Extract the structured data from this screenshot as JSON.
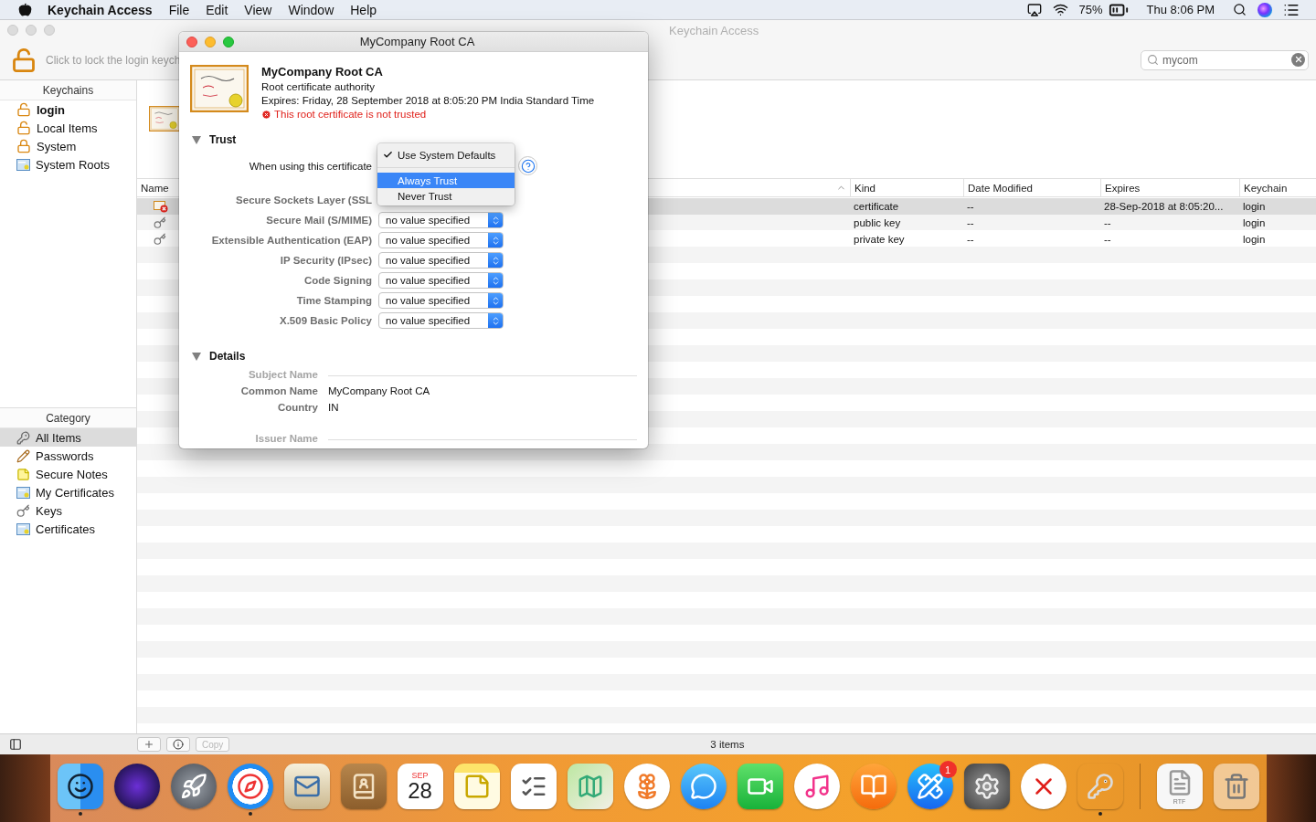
{
  "menubar": {
    "app": "Keychain Access",
    "menus": [
      "File",
      "Edit",
      "View",
      "Window",
      "Help"
    ],
    "battery": "75%",
    "clock": "Thu 8:06 PM"
  },
  "window": {
    "title": "Keychain Access",
    "lock_hint": "Click to lock the login keych",
    "search": {
      "value": "mycom"
    }
  },
  "keychains": {
    "header": "Keychains",
    "items": [
      {
        "label": "login",
        "default": true,
        "kind": "unlocked"
      },
      {
        "label": "Local Items",
        "default": false,
        "kind": "unlocked"
      },
      {
        "label": "System",
        "default": false,
        "kind": "locked"
      },
      {
        "label": "System Roots",
        "default": false,
        "kind": "cabinet"
      }
    ]
  },
  "categories": {
    "header": "Category",
    "items": [
      {
        "label": "All Items",
        "selected": true,
        "kind": "keys"
      },
      {
        "label": "Passwords",
        "selected": false,
        "kind": "pencil"
      },
      {
        "label": "Secure Notes",
        "selected": false,
        "kind": "note"
      },
      {
        "label": "My Certificates",
        "selected": false,
        "kind": "mycert"
      },
      {
        "label": "Keys",
        "selected": false,
        "kind": "key"
      },
      {
        "label": "Certificates",
        "selected": false,
        "kind": "cert"
      }
    ]
  },
  "table": {
    "columns": [
      "Name",
      "Kind",
      "Date Modified",
      "Expires",
      "Keychain"
    ],
    "rows": [
      {
        "kind": "certificate-error",
        "type": "certificate",
        "date_modified": "--",
        "expires": "28-Sep-2018 at 8:05:20...",
        "keychain": "login",
        "selected": true
      },
      {
        "kind": "key",
        "type": "public key",
        "date_modified": "--",
        "expires": "--",
        "keychain": "login",
        "selected": false
      },
      {
        "kind": "key",
        "type": "private key",
        "date_modified": "--",
        "expires": "--",
        "keychain": "login",
        "selected": false
      }
    ]
  },
  "status_bar": {
    "copy": {
      "label": "Copy",
      "disabled": true
    },
    "count": "3 items"
  },
  "dialog": {
    "title": "MyCompany Root CA",
    "name": "MyCompany Root CA",
    "subtitle": "Root certificate authority",
    "expires": "Expires: Friday, 28 September 2018 at 8:05:20 PM India Standard Time",
    "warning": "This root certificate is not trusted",
    "trust": {
      "heading": "Trust",
      "expanded": true,
      "when_label": "When using this certificate",
      "menu": [
        {
          "kind": "item",
          "label": "Use System Defaults",
          "checked": true,
          "selected": false
        },
        {
          "kind": "separator"
        },
        {
          "kind": "item",
          "label": "Always Trust",
          "checked": false,
          "selected": true
        },
        {
          "kind": "item",
          "label": "Never Trust",
          "checked": false,
          "selected": false
        }
      ],
      "policies": [
        {
          "label": "Secure Sockets Layer (SSL"
        },
        {
          "label": "Secure Mail (S/MIME)",
          "value": "no value specified"
        },
        {
          "label": "Extensible Authentication (EAP)",
          "value": "no value specified"
        },
        {
          "label": "IP Security (IPsec)",
          "value": "no value specified"
        },
        {
          "label": "Code Signing",
          "value": "no value specified"
        },
        {
          "label": "Time Stamping",
          "value": "no value specified"
        },
        {
          "label": "X.509 Basic Policy",
          "value": "no value specified"
        }
      ]
    },
    "details": {
      "heading": "Details",
      "expanded": true,
      "rows": [
        {
          "kind": "section",
          "label": "Subject Name"
        },
        {
          "kind": "field",
          "label": "Common Name",
          "value": "MyCompany Root CA"
        },
        {
          "kind": "field",
          "label": "Country",
          "value": "IN"
        },
        {
          "kind": "section",
          "label": "Issuer Name"
        }
      ]
    }
  },
  "dock": {
    "apps": [
      {
        "kind": "finder",
        "running": true
      },
      {
        "kind": "siri",
        "running": false
      },
      {
        "kind": "launchpad",
        "running": false
      },
      {
        "kind": "safari",
        "running": true
      },
      {
        "kind": "mail",
        "running": false
      },
      {
        "kind": "contacts",
        "running": false
      },
      {
        "kind": "calendar",
        "running": false,
        "month": "SEP",
        "day": "28"
      },
      {
        "kind": "notes",
        "running": false
      },
      {
        "kind": "reminders",
        "running": false
      },
      {
        "kind": "maps",
        "running": false
      },
      {
        "kind": "photos",
        "running": false
      },
      {
        "kind": "messages",
        "running": false
      },
      {
        "kind": "facetime",
        "running": false
      },
      {
        "kind": "music",
        "running": false
      },
      {
        "kind": "books",
        "running": false
      },
      {
        "kind": "appstore",
        "running": false,
        "badge": "1"
      },
      {
        "kind": "preferences",
        "running": false
      },
      {
        "kind": "cross",
        "running": false
      },
      {
        "kind": "keychain",
        "running": true
      },
      {
        "kind": "separator"
      },
      {
        "kind": "document",
        "running": false,
        "label": "RTF"
      },
      {
        "kind": "trash",
        "running": false
      }
    ]
  }
}
